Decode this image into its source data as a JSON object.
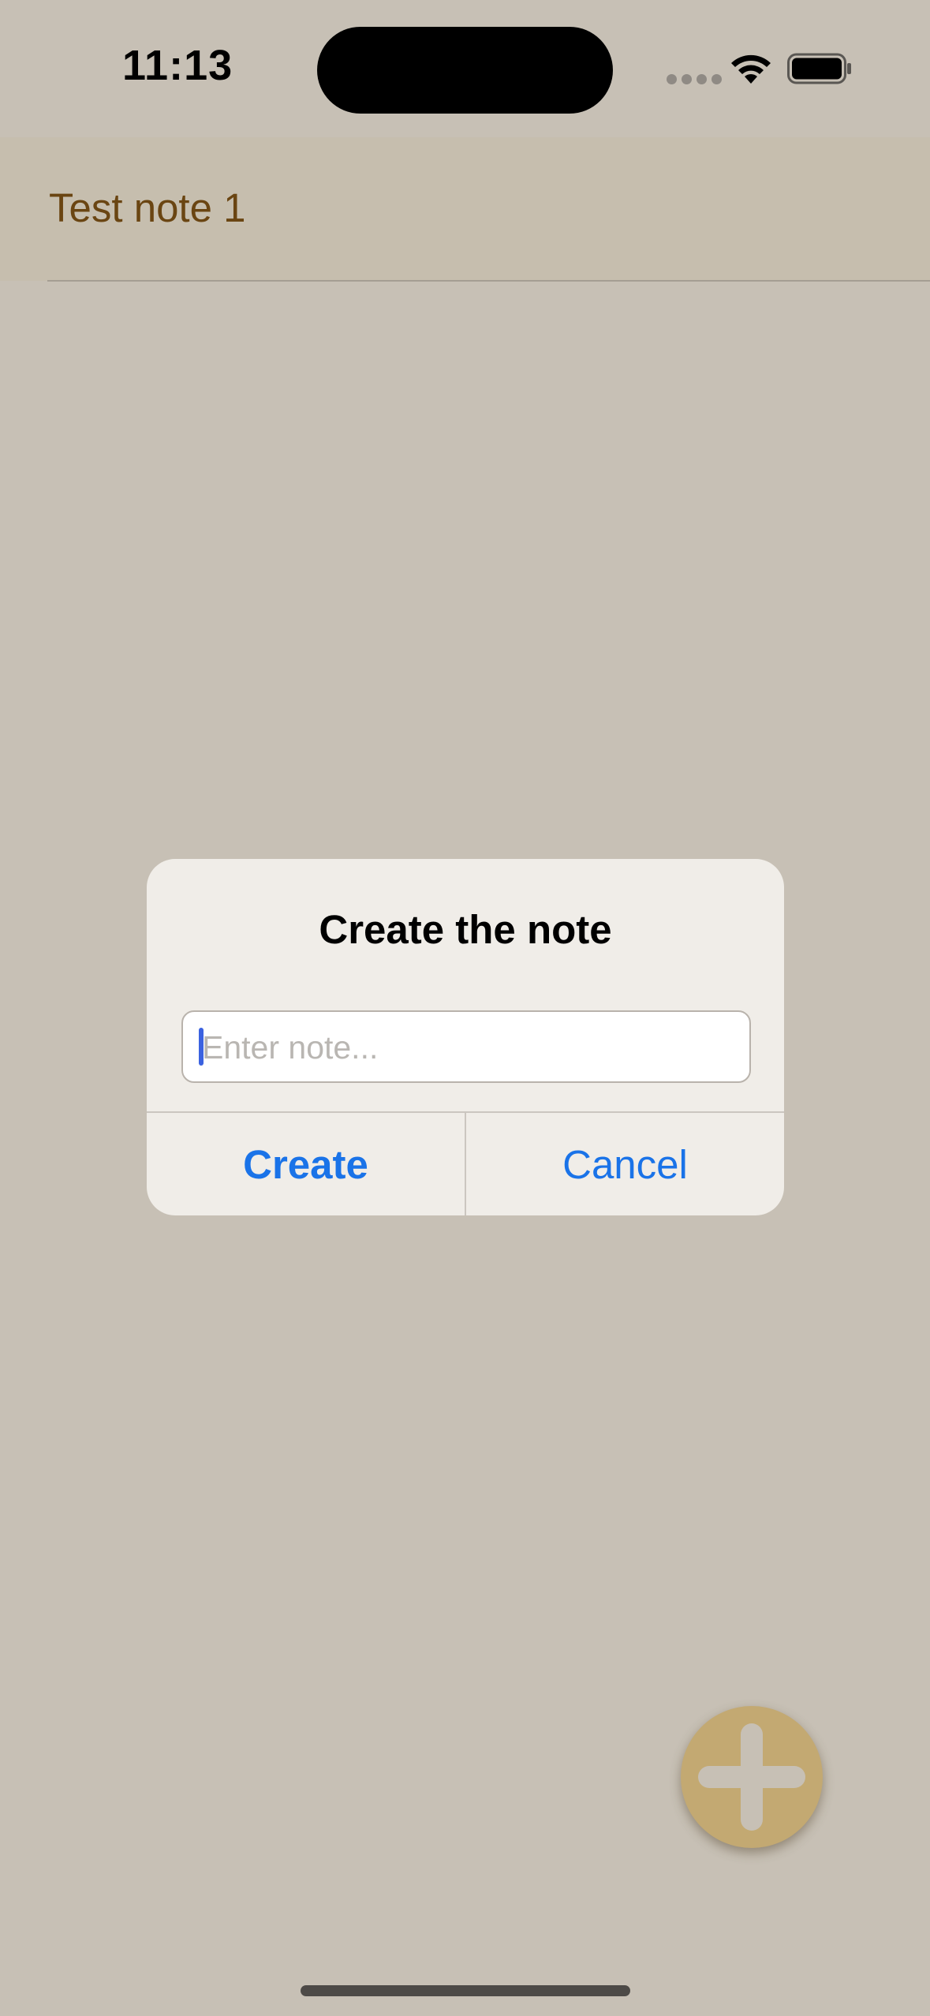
{
  "status_bar": {
    "time": "11:13",
    "wifi_icon": "wifi-icon",
    "battery_icon": "battery-icon"
  },
  "notes": [
    {
      "text": "Test note 1"
    }
  ],
  "alert": {
    "title": "Create the note",
    "input_placeholder": "Enter note...",
    "input_value": "",
    "create_label": "Create",
    "cancel_label": "Cancel"
  },
  "fab": {
    "icon": "plus-icon"
  },
  "colors": {
    "background": "#c7c0b5",
    "note_text": "#6a4512",
    "accent_blue": "#1a73e8",
    "fab": "#c3a972"
  }
}
